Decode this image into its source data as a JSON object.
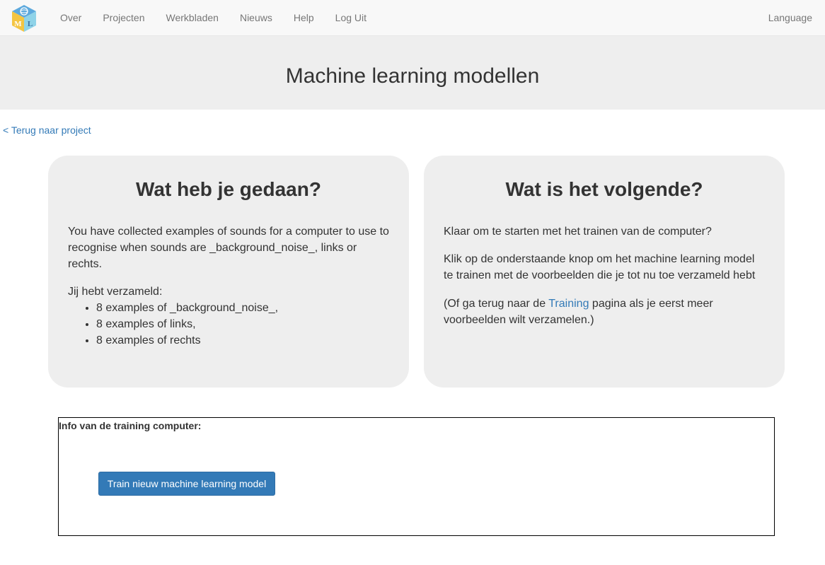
{
  "nav": {
    "logo_letters": [
      "M",
      "L"
    ],
    "items": [
      "Over",
      "Projecten",
      "Werkbladen",
      "Nieuws",
      "Help",
      "Log Uit"
    ],
    "language": "Language"
  },
  "header": {
    "title": "Machine learning modellen"
  },
  "back_link": "< Terug naar project",
  "done_card": {
    "title": "Wat heb je gedaan?",
    "intro": "You have collected examples of sounds for a computer to use to recognise when sounds are _background_noise_, links or rechts.",
    "collected_label": "Jij hebt verzameld:",
    "items": [
      "8 examples of _background_noise_,",
      "8 examples of links,",
      "8 examples of rechts"
    ]
  },
  "next_card": {
    "title": "Wat is het volgende?",
    "p1": "Klaar om te starten met het trainen van de computer?",
    "p2": "Klik op de onderstaande knop om het machine learning model te trainen met de voorbeelden die je tot nu toe verzameld hebt",
    "p3_before": "(Of ga terug naar de ",
    "p3_link": "Training",
    "p3_after": " pagina als je eerst meer voorbeelden wilt verzamelen.)"
  },
  "training_info": {
    "title": "Info van de training computer:",
    "button": "Train nieuw machine learning model"
  },
  "colors": {
    "navbar_bg": "#f8f8f8",
    "jumbotron_bg": "#eeeeee",
    "card_bg": "#eeeeee",
    "link": "#337ab7",
    "button_bg": "#337ab7"
  },
  "icons": {
    "logo": "ml-cube-logo-icon"
  }
}
